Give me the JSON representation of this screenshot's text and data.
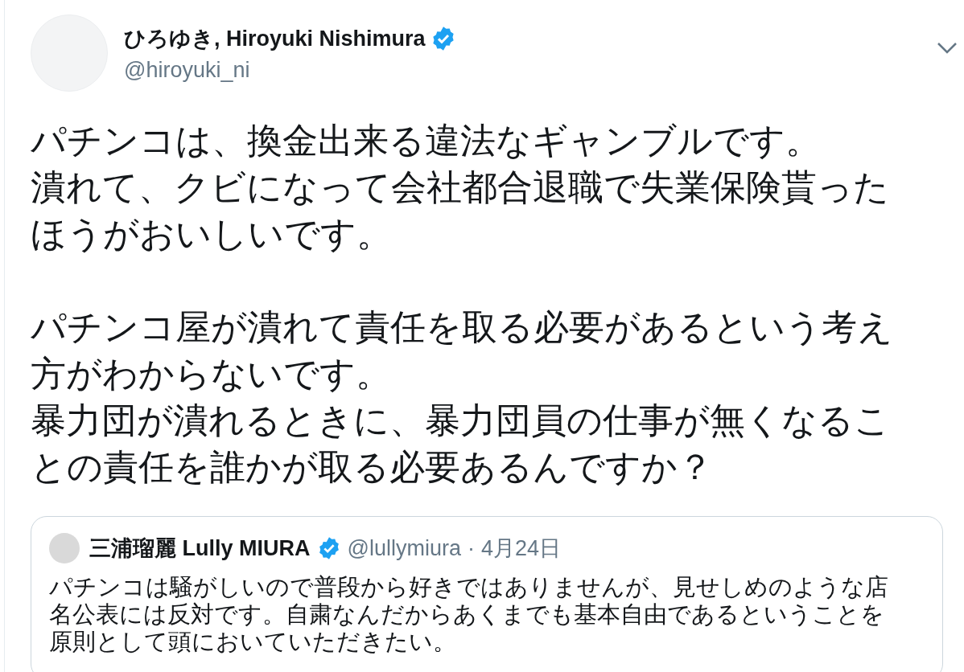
{
  "tweet": {
    "author": {
      "name": "ひろゆき, Hiroyuki Nishimura",
      "verified": true,
      "handle": "@hiroyuki_ni"
    },
    "paragraphs": [
      [
        "パチンコは、換金出来る違法なギャンブルです。",
        "潰れて、クビになって会社都合退職で失業保険貰ったほうがおいしいです。"
      ],
      [
        "パチンコ屋が潰れて責任を取る必要があるという考え方がわからないです。",
        "暴力団が潰れるときに、暴力団員の仕事が無くなることの責任を誰かが取る必要あるんですか？"
      ]
    ],
    "quoted": {
      "name": "三浦瑠麗 Lully MIURA",
      "verified": true,
      "handle": "@lullymiura",
      "separator": "·",
      "date": "4月24日",
      "text": "パチンコは騒がしいので普段から好きではありませんが、見せしめのような店名公表には反対です。自粛なんだからあくまでも基本自由であるということを原則として頭においていただきたい。"
    }
  }
}
